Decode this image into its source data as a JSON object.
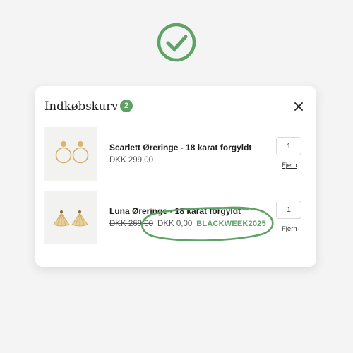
{
  "cart": {
    "title": "Indkøbskurv",
    "count": "2",
    "close_symbol": "✕",
    "items": [
      {
        "name": "Scarlett Øreringe - 18 karat forgyldt",
        "price": "DKK 299,00",
        "quantity": "1",
        "remove_label": "Fjern"
      },
      {
        "name": "Luna Øreringe - 18 karat forgyldt",
        "old_price": "DKK 269,00",
        "new_price": "DKK 0,00",
        "promo_code": "BLACKWEEK2025",
        "quantity": "1",
        "remove_label": "Fjern"
      }
    ]
  },
  "colors": {
    "accent_green": "#5fa266",
    "background": "#f4f4f4",
    "card": "#ffffff"
  },
  "icons": {
    "top": "check-circle-icon",
    "close": "close-icon"
  }
}
